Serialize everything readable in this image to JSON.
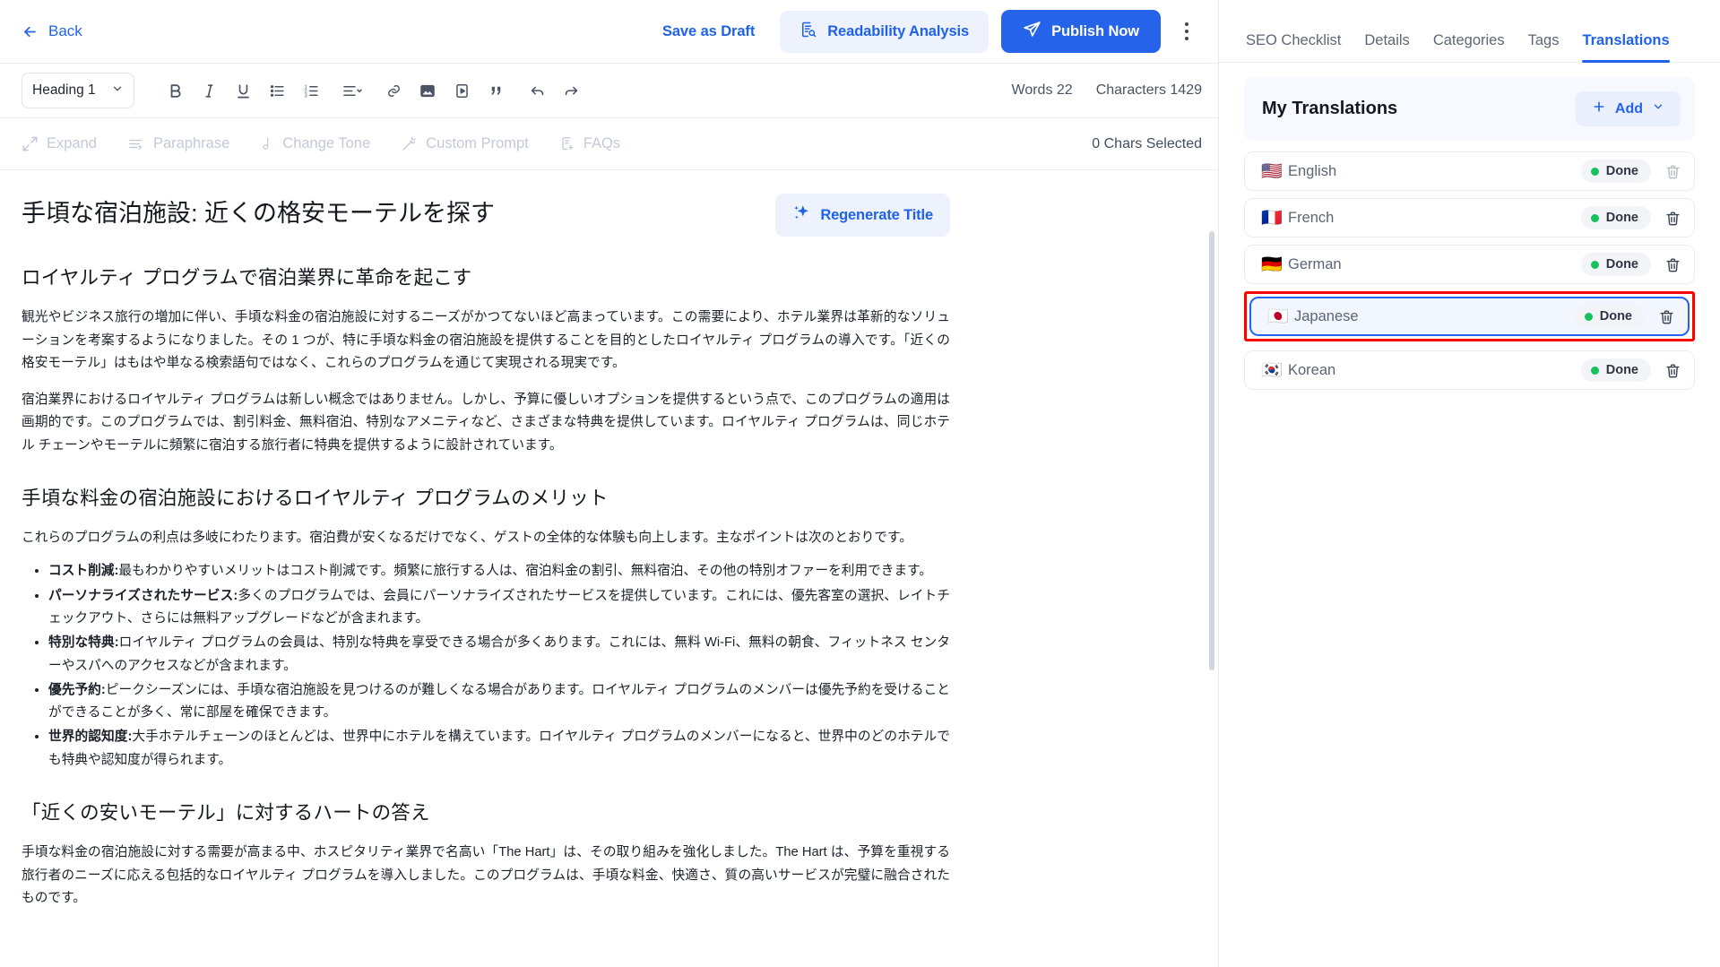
{
  "topbar": {
    "back_label": "Back",
    "back_icon": "arrow-left-icon",
    "save_draft_label": "Save as Draft",
    "readability_label": "Readability Analysis",
    "readability_icon": "document-search-icon",
    "publish_label": "Publish Now",
    "publish_icon": "send-icon",
    "more_icon": "kebab-menu-icon",
    "accent_color": "#2563eb",
    "publish_bg": "#2563eb",
    "readability_bg": "#eef2fd"
  },
  "format_toolbar": {
    "heading_value": "Heading 1",
    "heading_chevron": "chevron-down-icon",
    "icons": [
      "bold-icon",
      "italic-icon",
      "underline-icon",
      "bullet-list-icon",
      "numbered-list-icon",
      "align-icon",
      "link-icon",
      "image-icon",
      "video-icon",
      "blockquote-icon",
      "undo-icon",
      "redo-icon"
    ],
    "words_label": "Words 22",
    "characters_label": "Characters 1429"
  },
  "ai_toolbar": {
    "items": [
      {
        "label": "Expand",
        "icon": "expand-arrows-icon"
      },
      {
        "label": "Paraphrase",
        "icon": "paraphrase-icon"
      },
      {
        "label": "Change Tone",
        "icon": "music-note-icon"
      },
      {
        "label": "Custom Prompt",
        "icon": "magic-wand-icon"
      },
      {
        "label": "FAQs",
        "icon": "faq-document-icon"
      }
    ],
    "chars_selected": "0 Chars Selected"
  },
  "document": {
    "title": "手頃な宿泊施設: 近くの格安モーテルを探す",
    "regenerate_title_label": "Regenerate Title",
    "regenerate_icon": "sparkle-icon",
    "h2_1": "ロイヤルティ プログラムで宿泊業界に革命を起こす",
    "p1": "観光やビジネス旅行の増加に伴い、手頃な料金の宿泊施設に対するニーズがかつてないほど高まっています。この需要により、ホテル業界は革新的なソリューションを考案するようになりました。その 1 つが、特に手頃な料金の宿泊施設を提供することを目的としたロイヤルティ プログラムの導入です。「近くの格安モーテル」はもはや単なる検索語句ではなく、これらのプログラムを通じて実現される現実です。",
    "p2": "宿泊業界におけるロイヤルティ プログラムは新しい概念ではありません。しかし、予算に優しいオプションを提供するという点で、このプログラムの適用は画期的です。このプログラムでは、割引料金、無料宿泊、特別なアメニティなど、さまざまな特典を提供しています。ロイヤルティ プログラムは、同じホテル チェーンやモーテルに頻繁に宿泊する旅行者に特典を提供するように設計されています。",
    "h2_2": "手頃な料金の宿泊施設におけるロイヤルティ プログラムのメリット",
    "p3": "これらのプログラムの利点は多岐にわたります。宿泊費が安くなるだけでなく、ゲストの全体的な体験も向上します。主なポイントは次のとおりです。",
    "bullets": [
      {
        "bold": "コスト削減:",
        "text": "最もわかりやすいメリットはコスト削減です。頻繁に旅行する人は、宿泊料金の割引、無料宿泊、その他の特別オファーを利用できます。"
      },
      {
        "bold": "パーソナライズされたサービス:",
        "text": "多くのプログラムでは、会員にパーソナライズされたサービスを提供しています。これには、優先客室の選択、レイトチェックアウト、さらには無料アップグレードなどが含まれます。"
      },
      {
        "bold": "特別な特典:",
        "text": "ロイヤルティ プログラムの会員は、特別な特典を享受できる場合が多くあります。これには、無料 Wi-Fi、無料の朝食、フィットネス センターやスパへのアクセスなどが含まれます。"
      },
      {
        "bold": "優先予約:",
        "text": "ピークシーズンには、手頃な宿泊施設を見つけるのが難しくなる場合があります。ロイヤルティ プログラムのメンバーは優先予約を受けることができることが多く、常に部屋を確保できます。"
      },
      {
        "bold": "世界的認知度:",
        "text": "大手ホテルチェーンのほとんどは、世界中にホテルを構えています。ロイヤルティ プログラムのメンバーになると、世界中のどのホテルでも特典や認知度が得られます。"
      }
    ],
    "h2_3": "「近くの安いモーテル」に対するハートの答え",
    "p4": "手頃な料金の宿泊施設に対する需要が高まる中、ホスピタリティ業界で名高い「The Hart」は、その取り組みを強化しました。The Hart は、予算を重視する旅行者のニーズに応える包括的なロイヤルティ プログラムを導入しました。このプログラムは、手頃な料金、快適さ、質の高いサービスが完璧に融合されたものです。"
  },
  "sidebar": {
    "tabs": [
      {
        "label": "SEO Checklist",
        "active": false
      },
      {
        "label": "Details",
        "active": false
      },
      {
        "label": "Categories",
        "active": false
      },
      {
        "label": "Tags",
        "active": false
      },
      {
        "label": "Translations",
        "active": true
      }
    ],
    "panel_title": "My Translations",
    "add_label": "Add",
    "add_icon": "plus-icon",
    "add_chevron": "chevron-down-icon",
    "translations": [
      {
        "language": "English",
        "flag": "🇺🇸",
        "status": "Done",
        "selected": false,
        "delete_icon": "trash-icon",
        "delete_muted": true
      },
      {
        "language": "French",
        "flag": "🇫🇷",
        "status": "Done",
        "selected": false,
        "delete_icon": "trash-icon",
        "delete_muted": false
      },
      {
        "language": "German",
        "flag": "🇩🇪",
        "status": "Done",
        "selected": false,
        "delete_icon": "trash-icon",
        "delete_muted": false
      },
      {
        "language": "Japanese",
        "flag": "🇯🇵",
        "status": "Done",
        "selected": true,
        "delete_icon": "trash-icon",
        "delete_muted": false
      },
      {
        "language": "Korean",
        "flag": "🇰🇷",
        "status": "Done",
        "selected": false,
        "delete_icon": "trash-icon",
        "delete_muted": false
      }
    ],
    "highlight_color": "#ff0000",
    "status_dot_color": "#17c25d"
  }
}
